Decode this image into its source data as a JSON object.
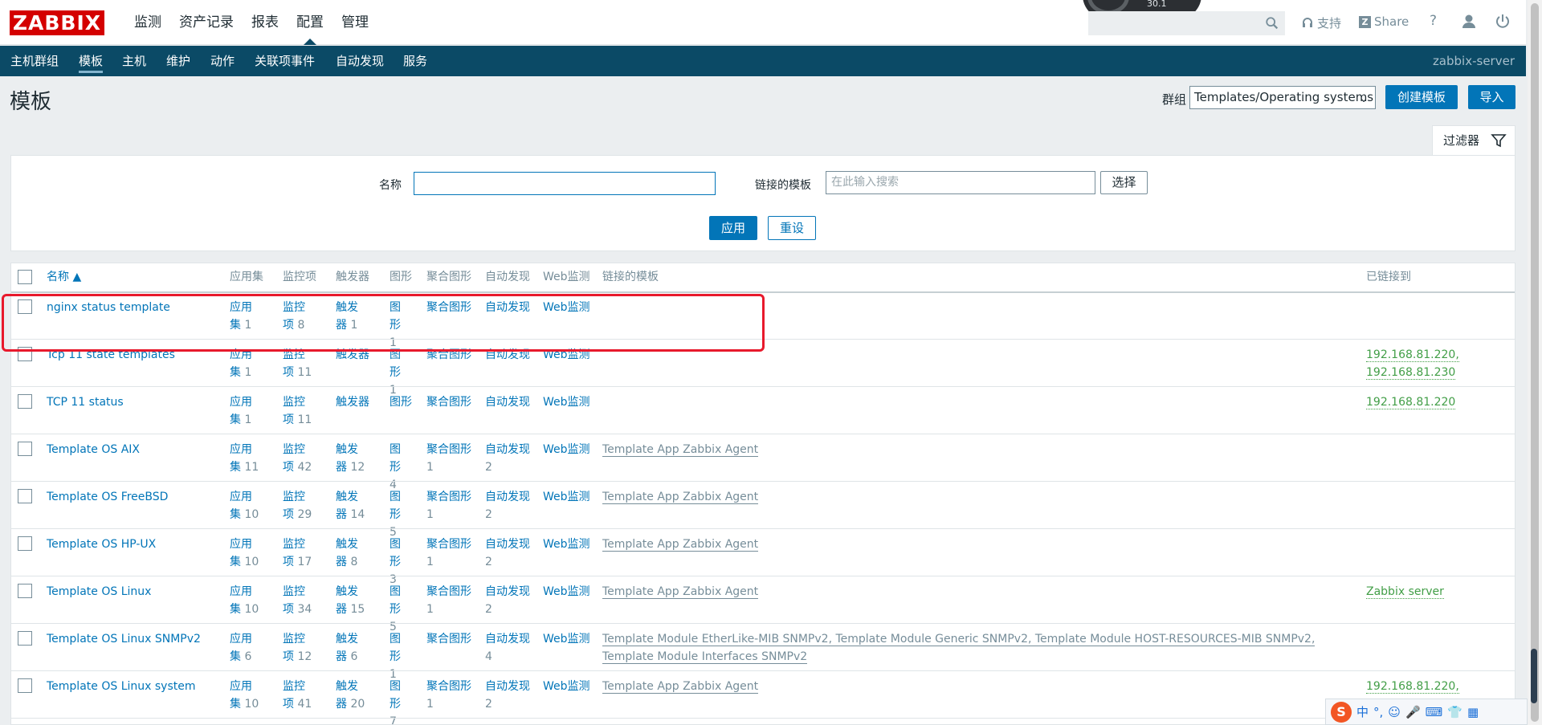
{
  "header": {
    "logo": "ZABBIX",
    "menu": [
      "监测",
      "资产记录",
      "报表",
      "配置",
      "管理"
    ],
    "active_menu": "配置",
    "gauge_text": "30.1",
    "support": "支持",
    "share": "Share",
    "help": "?"
  },
  "subnav": {
    "items": [
      "主机群组",
      "模板",
      "主机",
      "维护",
      "动作",
      "关联项事件",
      "自动发现",
      "服务"
    ],
    "active": "模板",
    "server": "zabbix-server"
  },
  "page": {
    "title": "模板",
    "group_label": "群组",
    "group_value": "Templates/Operating systems",
    "create_button": "创建模板",
    "import_button": "导入"
  },
  "filter": {
    "tab_label": "过滤器",
    "name_label": "名称",
    "name_value": "",
    "linked_label": "链接的模板",
    "linked_placeholder": "在此输入搜索",
    "select_button": "选择",
    "apply_button": "应用",
    "reset_button": "重设"
  },
  "table": {
    "headers": {
      "name": "名称 ▲",
      "apps": "应用集",
      "items": "监控项",
      "triggers": "触发器",
      "graphs": "图形",
      "screens": "聚合图形",
      "discovery": "自动发现",
      "web": "Web监测",
      "linked": "链接的模板",
      "linked_to": "已链接到"
    },
    "rows": [
      {
        "name": "nginx status template",
        "apps": "应用集",
        "apps_n": "1",
        "items": "监控项",
        "items_n": "8",
        "triggers": "触发器",
        "triggers_n": "1",
        "graphs": "图形",
        "graphs_n": "1",
        "screens": "聚合图形",
        "screens_n": "",
        "discovery": "自动发现",
        "discovery_n": "",
        "web": "Web监测",
        "linked": "",
        "linked2": "",
        "linked_to": "",
        "linked_to2": ""
      },
      {
        "name": "Tcp 11 state templates",
        "apps": "应用集",
        "apps_n": "1",
        "items": "监控项",
        "items_n": "11",
        "triggers": "触发器",
        "triggers_n": "",
        "graphs": "图形",
        "graphs_n": "1",
        "screens": "聚合图形",
        "screens_n": "",
        "discovery": "自动发现",
        "discovery_n": "",
        "web": "Web监测",
        "linked": "",
        "linked2": "",
        "linked_to": "192.168.81.220,",
        "linked_to2": "192.168.81.230"
      },
      {
        "name": "TCP 11 status",
        "apps": "应用集",
        "apps_n": "1",
        "items": "监控项",
        "items_n": "11",
        "triggers": "触发器",
        "triggers_n": "",
        "graphs": "图形",
        "graphs_n": "",
        "screens": "聚合图形",
        "screens_n": "",
        "discovery": "自动发现",
        "discovery_n": "",
        "web": "Web监测",
        "linked": "",
        "linked2": "",
        "linked_to": "192.168.81.220",
        "linked_to2": ""
      },
      {
        "name": "Template OS AIX",
        "apps": "应用集",
        "apps_n": "11",
        "items": "监控项",
        "items_n": "42",
        "triggers": "触发器",
        "triggers_n": "12",
        "graphs": "图形",
        "graphs_n": "4",
        "screens": "聚合图形",
        "screens_n": "1",
        "discovery": "自动发现",
        "discovery_n": "2",
        "web": "Web监测",
        "linked": "Template App Zabbix Agent",
        "linked2": "",
        "linked_to": "",
        "linked_to2": ""
      },
      {
        "name": "Template OS FreeBSD",
        "apps": "应用集",
        "apps_n": "10",
        "items": "监控项",
        "items_n": "29",
        "triggers": "触发器",
        "triggers_n": "14",
        "graphs": "图形",
        "graphs_n": "5",
        "screens": "聚合图形",
        "screens_n": "1",
        "discovery": "自动发现",
        "discovery_n": "2",
        "web": "Web监测",
        "linked": "Template App Zabbix Agent",
        "linked2": "",
        "linked_to": "",
        "linked_to2": ""
      },
      {
        "name": "Template OS HP-UX",
        "apps": "应用集",
        "apps_n": "10",
        "items": "监控项",
        "items_n": "17",
        "triggers": "触发器",
        "triggers_n": "8",
        "graphs": "图形",
        "graphs_n": "3",
        "screens": "聚合图形",
        "screens_n": "1",
        "discovery": "自动发现",
        "discovery_n": "2",
        "web": "Web监测",
        "linked": "Template App Zabbix Agent",
        "linked2": "",
        "linked_to": "",
        "linked_to2": ""
      },
      {
        "name": "Template OS Linux",
        "apps": "应用集",
        "apps_n": "10",
        "items": "监控项",
        "items_n": "34",
        "triggers": "触发器",
        "triggers_n": "15",
        "graphs": "图形",
        "graphs_n": "5",
        "screens": "聚合图形",
        "screens_n": "1",
        "discovery": "自动发现",
        "discovery_n": "2",
        "web": "Web监测",
        "linked": "Template App Zabbix Agent",
        "linked2": "",
        "linked_to": "Zabbix server",
        "linked_to2": ""
      },
      {
        "name": "Template OS Linux SNMPv2",
        "apps": "应用集",
        "apps_n": "6",
        "items": "监控项",
        "items_n": "12",
        "triggers": "触发器",
        "triggers_n": "6",
        "graphs": "图形",
        "graphs_n": "1",
        "screens": "聚合图形",
        "screens_n": "",
        "discovery": "自动发现",
        "discovery_n": "4",
        "web": "Web监测",
        "linked": "Template Module EtherLike-MIB SNMPv2, Template Module Generic SNMPv2, Template Module HOST-RESOURCES-MIB SNMPv2,",
        "linked2": "Template Module Interfaces SNMPv2",
        "linked_to": "",
        "linked_to2": ""
      },
      {
        "name": "Template OS Linux system",
        "apps": "应用集",
        "apps_n": "10",
        "items": "监控项",
        "items_n": "41",
        "triggers": "触发器",
        "triggers_n": "20",
        "graphs": "图形",
        "graphs_n": "7",
        "screens": "聚合图形",
        "screens_n": "1",
        "discovery": "自动发现",
        "discovery_n": "2",
        "web": "Web监测",
        "linked": "Template App Zabbix Agent",
        "linked2": "",
        "linked_to": "192.168.81.220,",
        "linked_to2": ""
      }
    ]
  },
  "ime": {
    "logo": "S",
    "items": [
      "中",
      "°,",
      "☺",
      "🎤",
      "⌨",
      "👕",
      "▦"
    ]
  },
  "colors": {
    "brand": "#d40000",
    "nav": "#0b4a66",
    "link": "#0275b8",
    "host": "#429e47",
    "annotation": "#e8192c"
  }
}
